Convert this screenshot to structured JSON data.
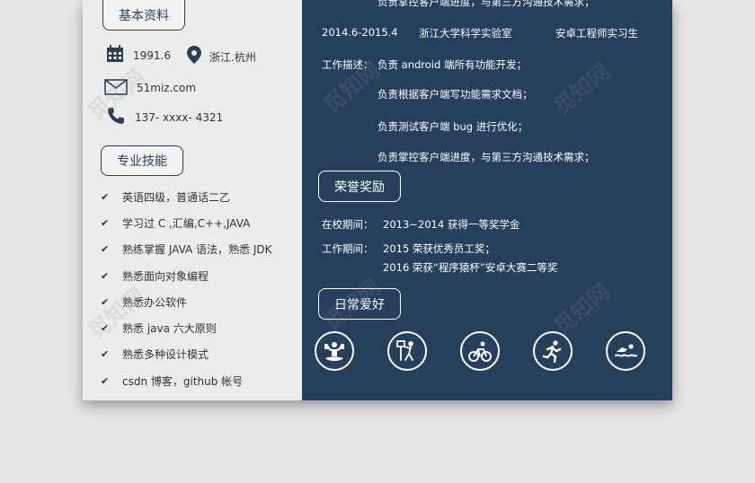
{
  "left": {
    "section_basic": "基本资料",
    "birth": "1991.6",
    "location": "浙江.杭州",
    "email": "51miz.com",
    "phone": "137- xxxx- 4321",
    "section_skills": "专业技能",
    "skills": [
      "英语四级，普通话二乙",
      "学习过 C ,汇编,C++,JAVA",
      "熟练掌握 JAVA 语法，熟悉 JDK",
      "熟悉面向对象编程",
      "熟悉办公软件",
      "熟悉 java 六大原则",
      "熟悉多种设计模式",
      "csdn 博客，github 帐号"
    ]
  },
  "right": {
    "top_cut_line": "负责掌控客户端进度，与第三方沟通技术需求；",
    "job_period": "2014.6-2015.4",
    "job_company": "浙江大学科学实验室",
    "job_title": "安卓工程师实习生",
    "desc_label": "工作描述：",
    "desc_lines": [
      "负责 android 端所有功能开发；",
      "负责根据客户端写功能需求文档；",
      "负责测试客户端 bug 进行优化；",
      "负责掌控客户端进度，与第三方沟通技术需求；"
    ],
    "section_honors": "荣誉奖励",
    "school_label": "在校期间：",
    "school_honor": "2013~2014 获得一等奖学金",
    "work_label": "工作期间：",
    "work_honors": [
      "2015 荣获优秀员工奖；",
      "2016 荣获“程序猿杯”安卓大赛二等奖"
    ],
    "section_hobbies": "日常爱好"
  },
  "icons": {
    "hobbies": [
      "weightlifting-icon",
      "basketball-icon",
      "cycling-icon",
      "running-icon",
      "swimming-icon"
    ]
  },
  "watermark": "觅知网",
  "colors": {
    "dark_panel": "#253f5c",
    "light_panel": "#ececec"
  }
}
